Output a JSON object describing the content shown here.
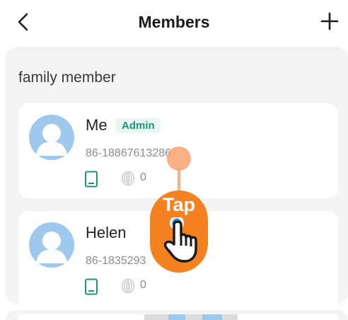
{
  "header": {
    "title": "Members",
    "back_icon": "chevron-left-icon",
    "add_icon": "plus-icon"
  },
  "section": {
    "label": "family member"
  },
  "members": [
    {
      "name": "Me",
      "badge": "Admin",
      "phone": "86-18867613286",
      "device_icon": "phone-device-icon",
      "fingerprint_icon": "fingerprint-icon",
      "fingerprint_count": "0"
    },
    {
      "name": "Helen",
      "badge": "",
      "phone": "86-1835293",
      "device_icon": "phone-device-icon",
      "fingerprint_icon": "fingerprint-icon",
      "fingerprint_count": "0"
    }
  ],
  "overlay": {
    "tap_label": "Tap",
    "hand_icon": "tap-hand-icon"
  },
  "colors": {
    "accent": "#1a9679",
    "avatar": "#9fc9ec",
    "tap_orange": "#f58220",
    "panel_bg": "#f4f4f4"
  }
}
